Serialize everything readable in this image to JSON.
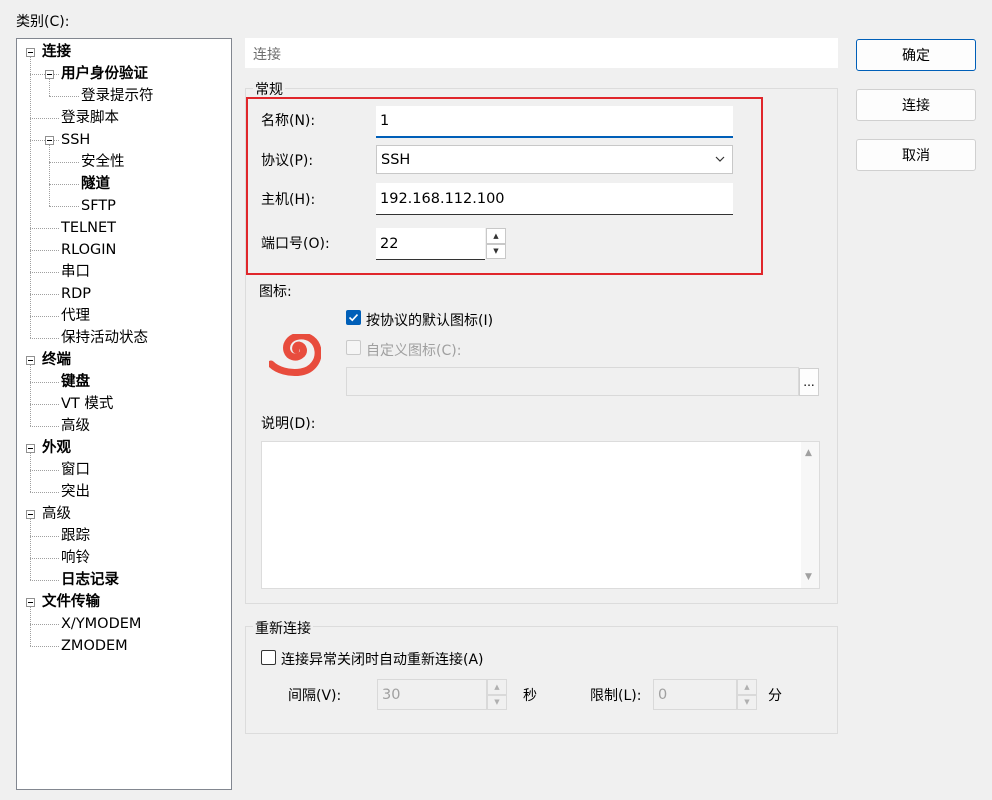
{
  "category_label": "类别(C):",
  "tree": [
    {
      "label": "连接",
      "bold": true,
      "depth": 0,
      "expander": true
    },
    {
      "label": "用户身份验证",
      "bold": true,
      "depth": 1,
      "expander": true
    },
    {
      "label": "登录提示符",
      "bold": false,
      "depth": 2,
      "expander": false
    },
    {
      "label": "登录脚本",
      "bold": false,
      "depth": 1,
      "expander": false
    },
    {
      "label": "SSH",
      "bold": false,
      "depth": 1,
      "expander": true
    },
    {
      "label": "安全性",
      "bold": false,
      "depth": 2,
      "expander": false
    },
    {
      "label": "隧道",
      "bold": true,
      "depth": 2,
      "expander": false
    },
    {
      "label": "SFTP",
      "bold": false,
      "depth": 2,
      "expander": false
    },
    {
      "label": "TELNET",
      "bold": false,
      "depth": 1,
      "expander": false
    },
    {
      "label": "RLOGIN",
      "bold": false,
      "depth": 1,
      "expander": false
    },
    {
      "label": "串口",
      "bold": false,
      "depth": 1,
      "expander": false
    },
    {
      "label": "RDP",
      "bold": false,
      "depth": 1,
      "expander": false
    },
    {
      "label": "代理",
      "bold": false,
      "depth": 1,
      "expander": false
    },
    {
      "label": "保持活动状态",
      "bold": false,
      "depth": 1,
      "expander": false
    },
    {
      "label": "终端",
      "bold": true,
      "depth": 0,
      "expander": true
    },
    {
      "label": "键盘",
      "bold": true,
      "depth": 1,
      "expander": false
    },
    {
      "label": "VT 模式",
      "bold": false,
      "depth": 1,
      "expander": false
    },
    {
      "label": "高级",
      "bold": false,
      "depth": 1,
      "expander": false
    },
    {
      "label": "外观",
      "bold": true,
      "depth": 0,
      "expander": true
    },
    {
      "label": "窗口",
      "bold": false,
      "depth": 1,
      "expander": false
    },
    {
      "label": "突出",
      "bold": false,
      "depth": 1,
      "expander": false
    },
    {
      "label": "高级",
      "bold": false,
      "depth": 0,
      "expander": true
    },
    {
      "label": "跟踪",
      "bold": false,
      "depth": 1,
      "expander": false
    },
    {
      "label": "响铃",
      "bold": false,
      "depth": 1,
      "expander": false
    },
    {
      "label": "日志记录",
      "bold": true,
      "depth": 1,
      "expander": false
    },
    {
      "label": "文件传输",
      "bold": true,
      "depth": 0,
      "expander": true
    },
    {
      "label": "X/YMODEM",
      "bold": false,
      "depth": 1,
      "expander": false
    },
    {
      "label": "ZMODEM",
      "bold": false,
      "depth": 1,
      "expander": false
    }
  ],
  "header_title": "连接",
  "general": {
    "title": "常规",
    "name_label": "名称(N):",
    "name_value": "1",
    "protocol_label": "协议(P):",
    "protocol_value": "SSH",
    "host_label": "主机(H):",
    "host_value": "192.168.112.100",
    "port_label": "端口号(O):",
    "port_value": "22"
  },
  "icon_section": {
    "title": "图标:",
    "default_icon_label": "按协议的默认图标(I)",
    "default_icon_checked": true,
    "custom_icon_label": "自定义图标(C):",
    "custom_icon_checked": false,
    "browse_label": "...",
    "icon_color": "#e84c3d"
  },
  "description_label": "说明(D):",
  "reconnect": {
    "title": "重新连接",
    "auto_label": "连接异常关闭时自动重新连接(A)",
    "auto_checked": false,
    "interval_label": "间隔(V):",
    "interval_value": "30",
    "seconds_unit": "秒",
    "limit_label": "限制(L):",
    "limit_value": "0",
    "minutes_unit": "分"
  },
  "buttons": {
    "ok": "确定",
    "connect": "连接",
    "cancel": "取消"
  },
  "colors": {
    "accent": "#005fb8",
    "highlight": "#e0262b"
  }
}
